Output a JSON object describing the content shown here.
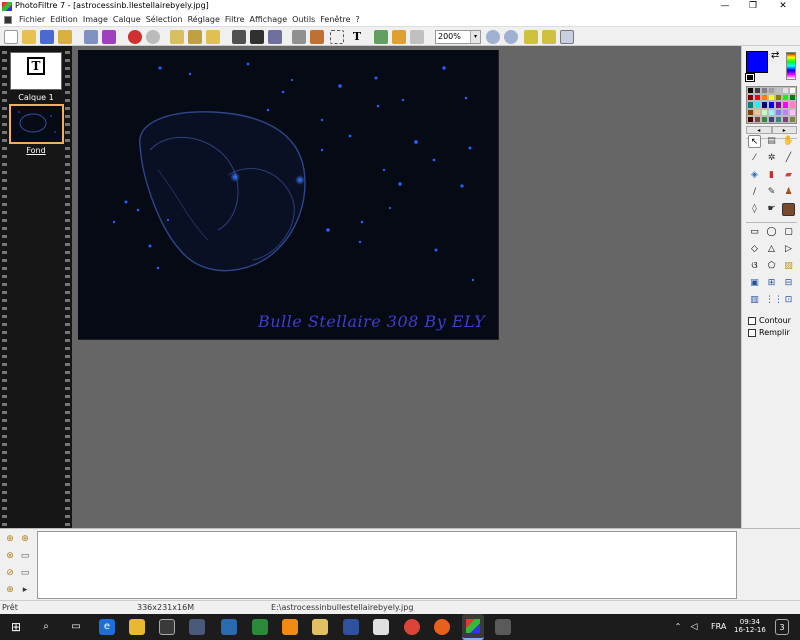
{
  "window": {
    "title": "PhotoFiltre 7 - [astrocessinb.llestellairebyely.jpg]",
    "minimize": "—",
    "restore": "❐",
    "close": "✕"
  },
  "menu": [
    "Fichier",
    "Edition",
    "Image",
    "Calque",
    "Sélection",
    "Réglage",
    "Filtre",
    "Affichage",
    "Outils",
    "Fenêtre",
    "?"
  ],
  "toolbar": {
    "zoom_value": "200%",
    "zoom_arrow": "▾",
    "text_tool_glyph": "T"
  },
  "layers": [
    {
      "label": "Calque 1",
      "icon": "T"
    },
    {
      "label": "Fond"
    }
  ],
  "canvas": {
    "watermark": "Bulle Stellaire 308 By ELY"
  },
  "colors": {
    "foreground": "#0000ff",
    "palette": [
      "#000000",
      "#404040",
      "#808080",
      "#a0a0a0",
      "#c0c0c0",
      "#e0e0e0",
      "#ffffff",
      "#800000",
      "#ff0000",
      "#ff8000",
      "#ffff00",
      "#808000",
      "#00ff00",
      "#008000",
      "#008080",
      "#00ffff",
      "#000080",
      "#0000ff",
      "#800080",
      "#ff00ff",
      "#ff80c0",
      "#804000",
      "#ffc080",
      "#c0ffc0",
      "#80ffff",
      "#8080ff",
      "#c080ff",
      "#ffc0ff",
      "#400000",
      "#804040",
      "#408040",
      "#404080",
      "#408080",
      "#804080",
      "#808040"
    ],
    "scroll_left": "◂",
    "scroll_right": "▸"
  },
  "tool_options": {
    "contour_label": "Contour",
    "fill_label": "Remplir"
  },
  "status": {
    "state": "Prêt",
    "dimensions": "336x231x16M",
    "path": "E:\\astrocessinbullestellairebyely.jpg"
  },
  "taskbar": {
    "language": "FRA",
    "time": "09:34",
    "date": "16-12-16",
    "notification_count": "3"
  }
}
